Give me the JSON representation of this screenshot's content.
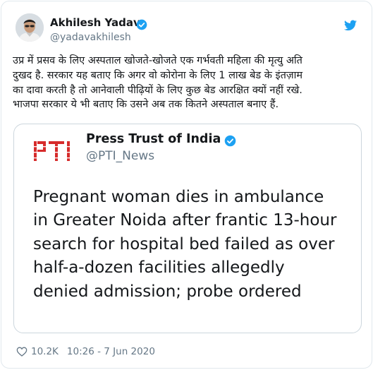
{
  "author": {
    "name": "Akhilesh Yadav",
    "handle": "@yadavakhilesh",
    "verified": true
  },
  "tweet_text": "उप्र में प्रसव के लिए अस्पताल खोजते-खोजते एक गर्भवती महिला की मृत्यु अति\nदुखद है. सरकार यह बताए कि अगर वो कोरोना के लिए 1 लाख बेड के इंतज़ाम\nका दावा करती है तो आनेवाली पीढ़ियों के लिए कुछ बेड आरक्षित क्यों नहीं रखे.\nभाजपा सरकार ये भी बताए कि उसने अब तक कितने अस्पताल बनाए हैं.",
  "quoted_tweet": {
    "name": "Press Trust of India",
    "handle": "@PTI_News",
    "verified": true,
    "logo_text": "PTI",
    "text": "Pregnant woman dies in ambulance\nin Greater Noida after frantic 13-hour\nsearch for hospital bed failed as over\nhalf-a-dozen facilities allegedly\ndenied admission; probe ordered"
  },
  "footer": {
    "likes": "10.2K",
    "timestamp": "10:26 - 7 Jun 2020"
  },
  "icons": {
    "verified": "verified-badge-icon",
    "bird": "twitter-bird-icon",
    "heart": "heart-icon"
  },
  "colors": {
    "verified_blue": "#1da1f2",
    "text_primary": "#14171a",
    "text_secondary": "#657786",
    "pti_red": "#d62b2b",
    "border": "#e1e8ed"
  }
}
